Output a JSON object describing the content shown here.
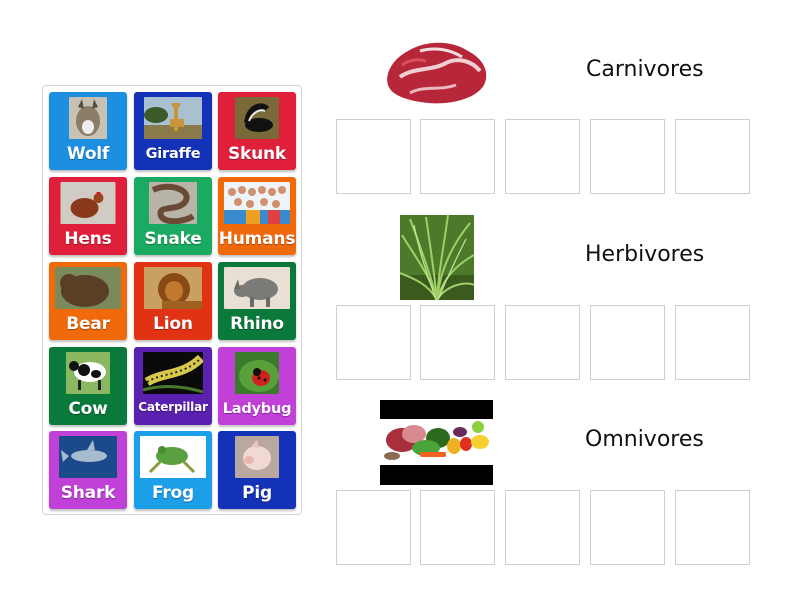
{
  "bank": {
    "tiles": [
      {
        "label": "Wolf",
        "color": "#1c8fe0",
        "image": "wolf-photo"
      },
      {
        "label": "Giraffe",
        "color": "#1432b8",
        "image": "giraffe-photo"
      },
      {
        "label": "Skunk",
        "color": "#e0203a",
        "image": "skunk-photo"
      },
      {
        "label": "Hens",
        "color": "#e0203a",
        "image": "hen-photo"
      },
      {
        "label": "Snake",
        "color": "#1aaa62",
        "image": "snake-photo"
      },
      {
        "label": "Humans",
        "color": "#f06a0c",
        "image": "humans-photo"
      },
      {
        "label": "Bear",
        "color": "#f06a0c",
        "image": "bear-photo"
      },
      {
        "label": "Lion",
        "color": "#e23214",
        "image": "lion-photo"
      },
      {
        "label": "Rhino",
        "color": "#0a7a3a",
        "image": "rhino-photo"
      },
      {
        "label": "Cow",
        "color": "#0a7a3a",
        "image": "cow-photo"
      },
      {
        "label": "Caterpillar",
        "color": "#5a20b0",
        "image": "caterpillar-photo"
      },
      {
        "label": "Ladybug",
        "color": "#c040d8",
        "image": "ladybug-photo"
      },
      {
        "label": "Shark",
        "color": "#c040d8",
        "image": "shark-photo"
      },
      {
        "label": "Frog",
        "color": "#1c9ee8",
        "image": "frog-photo"
      },
      {
        "label": "Pig",
        "color": "#1432b8",
        "image": "pig-photo"
      }
    ]
  },
  "categories": [
    {
      "title": "Carnivores",
      "image": "raw-meat-photo",
      "slots": 5
    },
    {
      "title": "Herbivores",
      "image": "grass-photo",
      "slots": 5
    },
    {
      "title": "Omnivores",
      "image": "meat-and-vegetables-photo",
      "slots": 5
    }
  ]
}
